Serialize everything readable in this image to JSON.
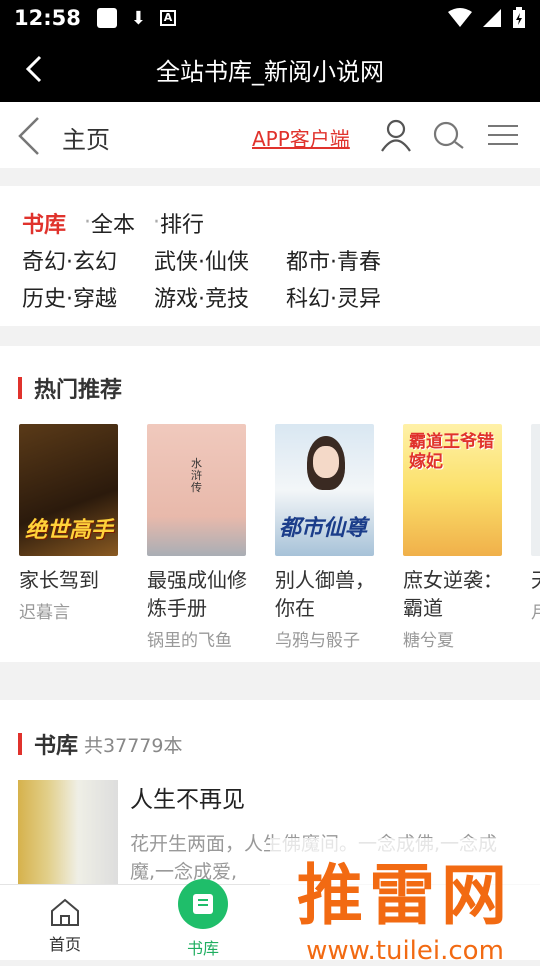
{
  "status": {
    "time": "12:58"
  },
  "titlebar": {
    "title": "全站书库_新阅小说网"
  },
  "header": {
    "home_label": "主页",
    "app_label": "APP客户端"
  },
  "categories": {
    "row1": [
      {
        "label": "书库",
        "active": true
      },
      {
        "label": "全本",
        "active": false
      },
      {
        "label": "排行",
        "active": false
      }
    ],
    "row2": [
      "奇幻·玄幻",
      "武侠·仙侠",
      "都市·青春"
    ],
    "row3": [
      "历史·穿越",
      "游戏·竞技",
      "科幻·灵异"
    ]
  },
  "hot": {
    "title": "热门推荐",
    "books": [
      {
        "name": "家长驾到",
        "author": "迟暮言",
        "cover_text": "绝世高手"
      },
      {
        "name": "最强成仙修炼手册",
        "author": "锅里的飞鱼",
        "cover_text": "水浒传"
      },
      {
        "name": "别人御兽，你在",
        "author": "乌鸦与骰子",
        "cover_text": "都市仙尊"
      },
      {
        "name": "庶女逆袭：霸道",
        "author": "糖兮夏",
        "cover_text": "霸道王爷错嫁妃"
      },
      {
        "name": "天的",
        "author": "月",
        "cover_text": ""
      }
    ]
  },
  "library": {
    "title": "书库",
    "count": "共37779本",
    "item": {
      "name": "人生不再见",
      "desc": "花开生两面，人生佛魔间。一念成佛,一念成魔,一念成爱,"
    }
  },
  "tabs": {
    "home": "首页",
    "library": "书库"
  },
  "watermark": {
    "text": "推雷网",
    "url": "www.tuilei.com"
  }
}
